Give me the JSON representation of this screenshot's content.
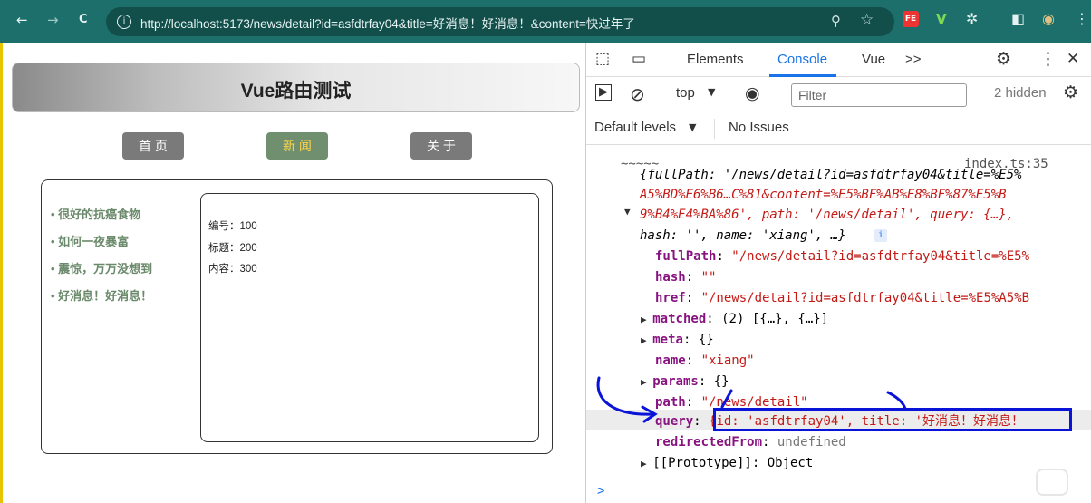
{
  "browser": {
    "url": "http://localhost:5173/news/detail?id=asfdtrfay04&title=好消息！好消息！&content=快过年了",
    "back_icon": "←",
    "forward_icon": "→",
    "reload_icon": "C",
    "info_icon": "i",
    "zoom_icon": "⚲",
    "star_icon": "☆",
    "fe_badge": "FE",
    "v_ext": "V",
    "puzzle_icon": "✲",
    "sidebar_icon": "◧",
    "avatar_icon": "◉",
    "menu_icon": "⋮"
  },
  "page": {
    "title": "Vue路由测试",
    "nav": {
      "home": "首 页",
      "news": "新 闻",
      "about": "关 于"
    },
    "news_items": [
      "很好的抗癌食物",
      "如何一夜暴富",
      "震惊，万万没想到",
      "好消息！好消息！"
    ],
    "detail": {
      "id_line": "编号：100",
      "title_line": "标题：200",
      "content_line": "内容：300"
    }
  },
  "devtools": {
    "tabs": {
      "elements": "Elements",
      "console": "Console",
      "vue": "Vue",
      "more": ">>"
    },
    "icons": {
      "inspect": "⬚",
      "device": "▭",
      "settings": "⚙",
      "kebab": "⋮",
      "close": "✕",
      "sidebar_toggle": "▶",
      "clear": "⊘",
      "eye": "◉",
      "gear_small": "⚙"
    },
    "context": "top",
    "filter_placeholder": "Filter",
    "hidden": "2 hidden",
    "levels": "Default levels",
    "issues": "No Issues"
  },
  "console": {
    "source_link": "index.ts:35",
    "tilde": "~~~~~",
    "obj_line1": "{fullPath: '/news/detail?id=asfdtrfay04&title=%E5%",
    "obj_line2": "A5%BD%E6%B6…C%81&content=%E5%BF%AB%E8%BF%87%E5%B",
    "obj_line3": "9%B4%E4%BA%86', path: '/news/detail', query: {…},",
    "obj_line4": "hash: '', name: 'xiang', …}",
    "info_badge": "i",
    "props": [
      {
        "key": "fullPath",
        "value": "\"/news/detail?id=asfdtrfay04&title=%E5%",
        "type": "string"
      },
      {
        "key": "hash",
        "value": "\"\"",
        "type": "string"
      },
      {
        "key": "href",
        "value": "\"/news/detail?id=asfdtrfay04&title=%E5%A5%B",
        "type": "string"
      },
      {
        "key": "matched",
        "value": "(2) [{…}, {…}]",
        "type": "expand"
      },
      {
        "key": "meta",
        "value": "{}",
        "type": "expand"
      },
      {
        "key": "name",
        "value": "\"xiang\"",
        "type": "string"
      },
      {
        "key": "params",
        "value": "{}",
        "type": "expand"
      },
      {
        "key": "path",
        "value": "\"/news/detail\"",
        "type": "string"
      },
      {
        "key": "query",
        "value": "{id: 'asfdtrfay04', title: '好消息！好消息！",
        "type": "highlight"
      },
      {
        "key": "redirectedFrom",
        "value": "undefined",
        "type": "undef"
      },
      {
        "key": "[[Prototype]]",
        "value": "Object",
        "type": "proto"
      }
    ],
    "prompt": ">"
  },
  "colors": {
    "toolbar": "#1c6f6b",
    "annotation_blue": "#0a14d8",
    "console_tab": "#1a73e8",
    "key": "#881280",
    "string": "#c41a16"
  }
}
